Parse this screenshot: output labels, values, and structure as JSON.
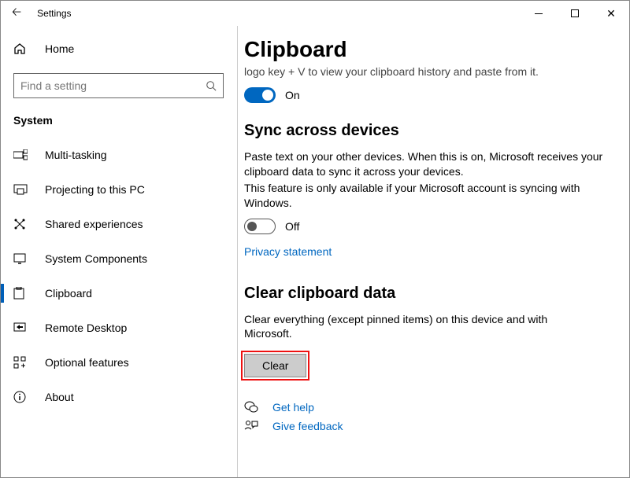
{
  "titlebar": {
    "title": "Settings"
  },
  "sidebar": {
    "home": "Home",
    "search_placeholder": "Find a setting",
    "category": "System",
    "items": [
      {
        "label": "Multi-tasking"
      },
      {
        "label": "Projecting to this PC"
      },
      {
        "label": "Shared experiences"
      },
      {
        "label": "System Components"
      },
      {
        "label": "Clipboard"
      },
      {
        "label": "Remote Desktop"
      },
      {
        "label": "Optional features"
      },
      {
        "label": "About"
      }
    ]
  },
  "main": {
    "page_title": "Clipboard",
    "truncated_line": "logo key + V to view your clipboard history and paste from it.",
    "history_toggle": "On",
    "sync_heading": "Sync across devices",
    "sync_p1": "Paste text on your other devices. When this is on, Microsoft receives your clipboard data to sync it across your devices.",
    "sync_p2": "This feature is only available if your Microsoft account is syncing with Windows.",
    "sync_toggle": "Off",
    "privacy_link": "Privacy statement",
    "clear_heading": "Clear clipboard data",
    "clear_p": "Clear everything (except pinned items) on this device and with Microsoft.",
    "clear_button": "Clear",
    "help_link": "Get help",
    "feedback_link": "Give feedback"
  }
}
